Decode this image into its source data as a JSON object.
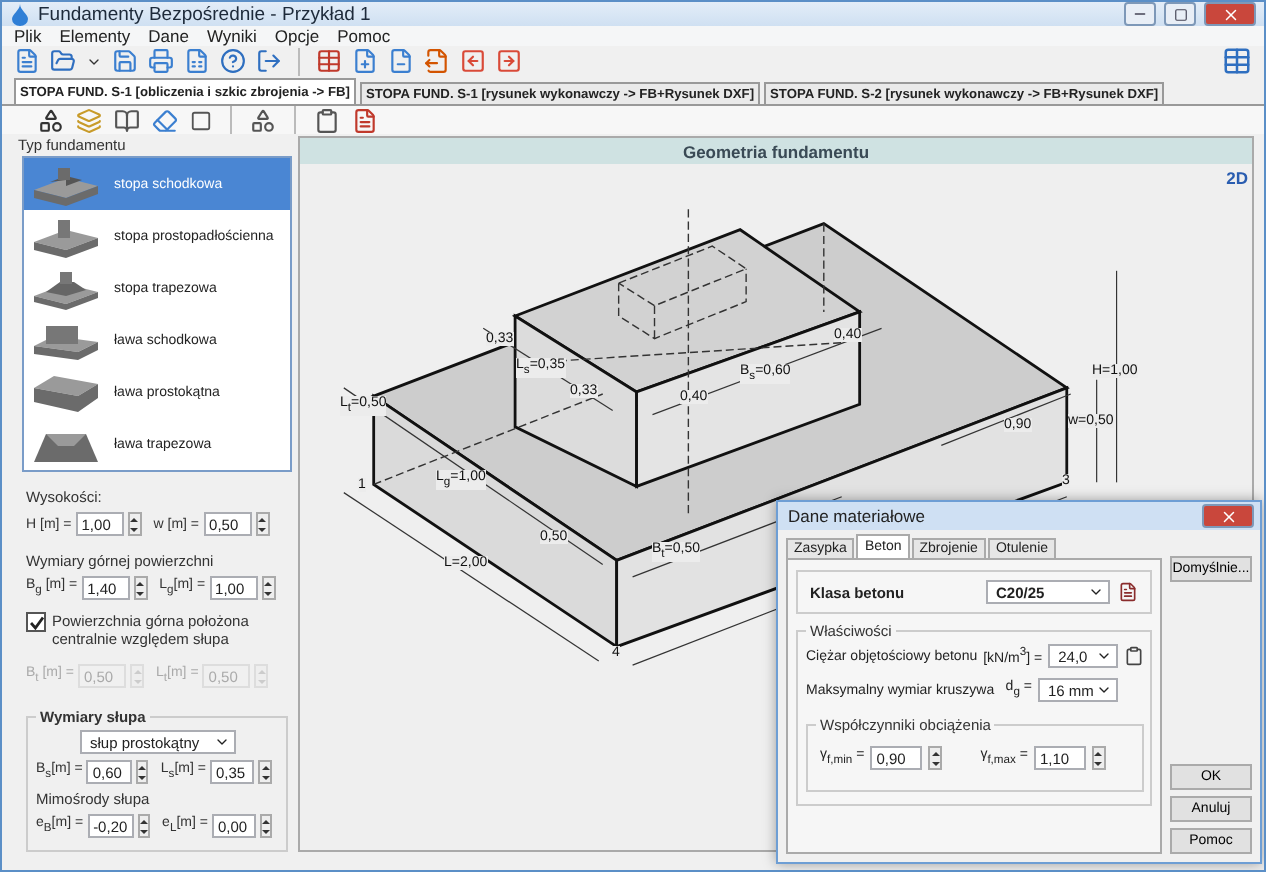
{
  "window": {
    "title": "Fundamenty Bezpośrednie - Przykład 1"
  },
  "menu": [
    "Plik",
    "Elementy",
    "Dane",
    "Wyniki",
    "Opcje",
    "Pomoc"
  ],
  "tabs": [
    {
      "label": "STOPA FUND. S-1 [obliczenia i szkic zbrojenia -> FB]",
      "selected": true
    },
    {
      "label": "STOPA FUND. S-1 [rysunek wykonawczy ->  FB+Rysunek DXF]",
      "selected": false
    },
    {
      "label": "STOPA FUND. S-2 [rysunek wykonawczy -> FB+Rysunek DXF]",
      "selected": false
    }
  ],
  "left_panel": {
    "type_label": "Typ fundamentu",
    "type_list": [
      {
        "label": "stopa schodkowa",
        "kind": "steppad",
        "selected": true
      },
      {
        "label": "stopa prostopadłościenna",
        "kind": "boxpad",
        "selected": false
      },
      {
        "label": "stopa trapezowa",
        "kind": "trappad",
        "selected": false
      },
      {
        "label": "ława schodkowa",
        "kind": "stepstrip",
        "selected": false
      },
      {
        "label": "ława prostokątna",
        "kind": "boxstrip",
        "selected": false
      },
      {
        "label": "ława trapezowa",
        "kind": "trapstrip",
        "selected": false
      }
    ],
    "heights": {
      "title": "Wysokości:",
      "fields": [
        {
          "label": "H [m] =",
          "value": "1,00",
          "disabled": false
        },
        {
          "label": "w [m] =",
          "value": "0,50",
          "disabled": false
        }
      ]
    },
    "top_surface": {
      "title": "Wymiary górnej powierzchni",
      "fields": [
        {
          "label": "B$_{g}$ [m] =",
          "value": "1,40",
          "disabled": false
        },
        {
          "label": "L$_{g}$[m] =",
          "value": "1,00",
          "disabled": false
        }
      ]
    },
    "centered": {
      "label": "Powierzchnia górna położona centralnie względem słupa",
      "checked": true
    },
    "offset_fields": [
      {
        "label": "B$_{t}$ [m] =",
        "value": "0,50",
        "disabled": true
      },
      {
        "label": "L$_{t}$[m] =",
        "value": "0,50",
        "disabled": true
      }
    ],
    "column": {
      "title": "Wymiary słupa",
      "shape": "słup prostokątny",
      "fields": [
        {
          "label": "B$_{s}$[m] =",
          "value": "0,60",
          "disabled": false
        },
        {
          "label": "L$_{s}$[m] =",
          "value": "0,35",
          "disabled": false
        }
      ],
      "eccentricity_title": "Mimośrody słupa",
      "eccentricity_fields": [
        {
          "label": "e$_{B}$[m] =",
          "value": "-0,20",
          "disabled": false
        },
        {
          "label": "e$_{L}$[m] =",
          "value": "0,00",
          "disabled": false
        }
      ]
    }
  },
  "canvas": {
    "title": "Geometria fundamentu",
    "view_toggle": "2D",
    "drawing_labels": [
      "0,33",
      "L$_{s}$=0,35",
      "0,33",
      "0,40",
      "B$_{s}$=0,60",
      "0,40",
      "H=1,00",
      "w=0,50",
      "0,90",
      "L$_{t}$=0,50",
      "L$_{g}$=1,00",
      "0,50",
      "L=2,00",
      "B$_{t}$=0,50",
      "1",
      "3",
      "4"
    ]
  },
  "dialog": {
    "title": "Dane materiałowe",
    "tabs": [
      {
        "label": "Zasypka",
        "selected": false
      },
      {
        "label": "Beton",
        "selected": true
      },
      {
        "label": "Zbrojenie",
        "selected": false
      },
      {
        "label": "Otulenie",
        "selected": false
      }
    ],
    "class_label": "Klasa betonu",
    "class_value": "C20/25",
    "properties_title": "Właściwości",
    "weight": {
      "label": "Ciężar objętościowy betonu",
      "unit": "[kN/m$^{3}$] =",
      "value": "24,0"
    },
    "aggregate": {
      "label": "Maksymalny wymiar kruszywa",
      "unit": "d$_{g}$ =",
      "value": "16 mm"
    },
    "factors_title": "Współczynniki obciążenia",
    "factors": [
      {
        "label": "γ$_{f,min}$ =",
        "value": "0,90"
      },
      {
        "label": "γ$_{f,max}$ =",
        "value": "1,10"
      }
    ],
    "buttons": {
      "defaults": "Domyślnie...",
      "ok": "OK",
      "cancel": "Anuluj",
      "help": "Pomoc"
    }
  }
}
